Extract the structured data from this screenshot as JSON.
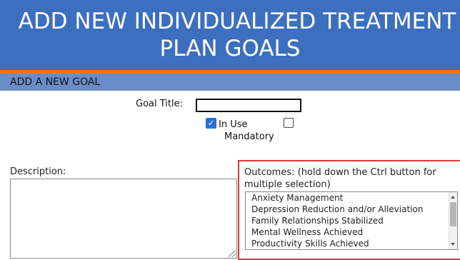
{
  "banner": {
    "title_line1": "ADD NEW INDIVIDUALIZED TREATMENT",
    "title_line2": "PLAN GOALS",
    "background_color": "#3d6fbf",
    "accent_color": "#e87722"
  },
  "section": {
    "title": "ADD A NEW GOAL"
  },
  "form": {
    "goal_title_label": "Goal Title:",
    "goal_title_value": "",
    "in_use_label": "In Use",
    "in_use_checked": true,
    "mandatory_label": "Mandatory",
    "mandatory_checked": false,
    "description_label": "Description:",
    "description_value": "",
    "outcomes_label": "Outcomes: (hold down the Ctrl button for multiple selection)",
    "outcomes_options": [
      "Anxiety Management",
      "Depression Reduction and/or Alleviation",
      "Family Relationships Stabilized",
      "Mental Wellness Achieved",
      "Productivity Skills Achieved"
    ]
  },
  "colors": {
    "highlight_border": "#d83a3a",
    "section_bar": "#6b8dc7"
  },
  "icons": {
    "check": "checkmark-icon"
  }
}
